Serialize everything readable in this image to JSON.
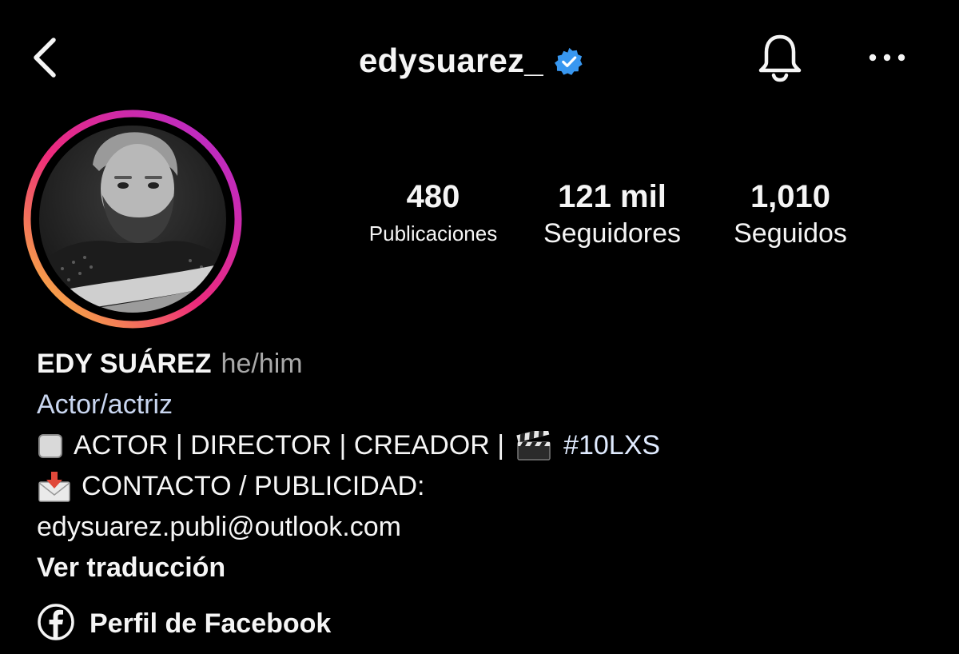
{
  "header": {
    "username": "edysuarez_",
    "verified": true,
    "back_icon": "chevron-left-icon",
    "bell_icon": "bell-icon",
    "more_icon": "more-horizontal-icon",
    "verified_color": "#3897f0"
  },
  "stats": [
    {
      "value": "480",
      "label": "Publicaciones"
    },
    {
      "value": "121 mil",
      "label": "Seguidores"
    },
    {
      "value": "1,010",
      "label": "Seguidos"
    }
  ],
  "bio": {
    "name": "EDY SUÁREZ",
    "pronouns": "he/him",
    "category": "Actor/actriz",
    "line1_text": "ACTOR | DIRECTOR | CREADOR |",
    "hashtag": "#10LXS",
    "line2_text": "CONTACTO / PUBLICIDAD:",
    "email": "edysuarez.publi@outlook.com",
    "translate": "Ver traducción"
  },
  "links": {
    "facebook_label": "Perfil de Facebook",
    "facebook_icon": "facebook-icon"
  },
  "colors": {
    "background": "#000000",
    "text": "#f5f5f5",
    "muted": "#a8a8a8",
    "story_ring_start": "#f9ce34",
    "story_ring_mid": "#ee2a7b",
    "story_ring_end": "#b02bd6"
  }
}
